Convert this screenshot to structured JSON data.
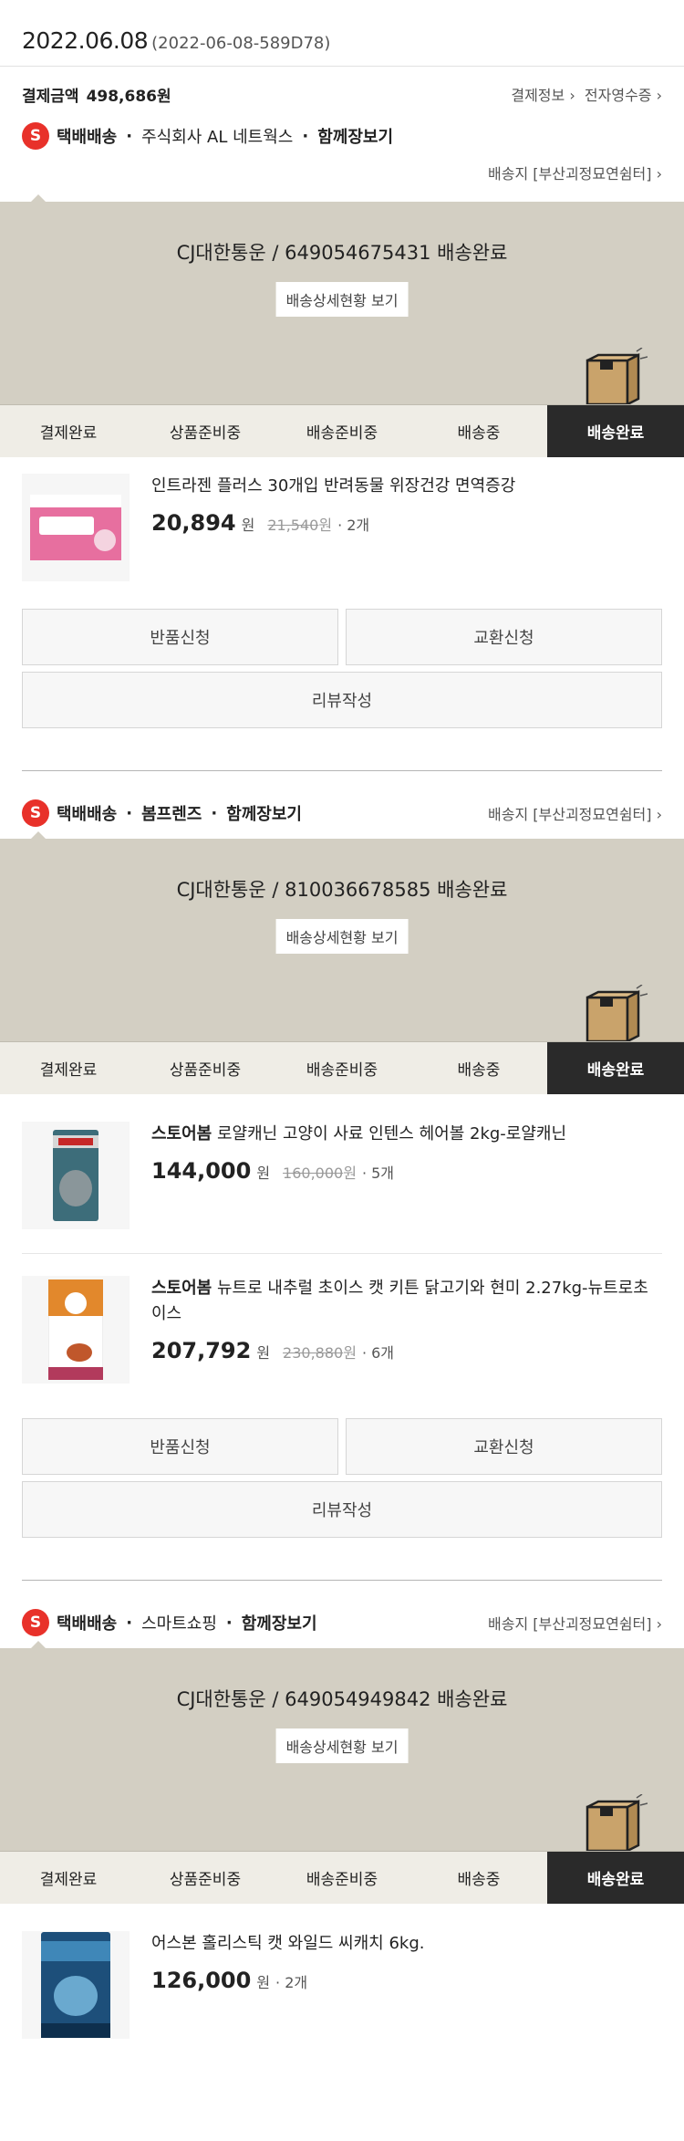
{
  "order": {
    "date": "2022.06.08",
    "order_id": "(2022-06-08-589D78)",
    "pay_label": "결제금액",
    "pay_amount": "498,686원",
    "payment_info_link": "결제정보 ›",
    "receipt_link": "전자영수증 ›"
  },
  "shipments": [
    {
      "badge": "S",
      "method": "택배배송",
      "seller": "주식회사 AL 네트웍스",
      "cart_link": "함께장보기",
      "address": "배송지 [부산괴정묘연쉼터] ›",
      "tracking_text": "CJ대한통운 / 649054675431 배송완료",
      "tracking_button": "배송상세현황 보기",
      "steps": [
        "결제완료",
        "상품준비중",
        "배송준비중",
        "배송중",
        "배송완료"
      ],
      "items": [
        {
          "store": "",
          "name": "인트라젠 플러스 30개입 반려동물 위장건강 면역증강",
          "price": "20,894",
          "won": "원",
          "original": "21,540",
          "original_won": "원",
          "qty": "· 2개",
          "thumb_label": "Intragen"
        }
      ],
      "buttons": {
        "return": "반품신청",
        "exchange": "교환신청",
        "review": "리뷰작성"
      }
    },
    {
      "badge": "S",
      "method": "택배배송",
      "seller": "봄프렌즈",
      "cart_link": "함께장보기",
      "address": "배송지 [부산괴정묘연쉼터] ›",
      "tracking_text": "CJ대한통운 / 810036678585 배송완료",
      "tracking_button": "배송상세현황 보기",
      "steps": [
        "결제완료",
        "상품준비중",
        "배송준비중",
        "배송중",
        "배송완료"
      ],
      "items": [
        {
          "store": "스토어봄",
          "name": "로얄캐닌 고양이 사료 인텐스 헤어볼 2kg-로얄캐닌",
          "price": "144,000",
          "won": "원",
          "original": "160,000",
          "original_won": "원",
          "qty": "· 5개",
          "thumb_label": "ROYAL CANIN"
        },
        {
          "store": "스토어봄",
          "name": "뉴트로 내추럴 초이스 캣 키튼 닭고기와 현미 2.27kg-뉴트로초이스",
          "price": "207,792",
          "won": "원",
          "original": "230,880",
          "original_won": "원",
          "qty": "· 6개",
          "thumb_label": "Nutro"
        }
      ],
      "buttons": {
        "return": "반품신청",
        "exchange": "교환신청",
        "review": "리뷰작성"
      }
    },
    {
      "badge": "S",
      "method": "택배배송",
      "seller": "스마트쇼핑",
      "cart_link": "함께장보기",
      "address": "배송지 [부산괴정묘연쉼터] ›",
      "tracking_text": "CJ대한통운 / 649054949842 배송완료",
      "tracking_button": "배송상세현황 보기",
      "steps": [
        "결제완료",
        "상품준비중",
        "배송준비중",
        "배송중",
        "배송완료"
      ],
      "items": [
        {
          "store": "",
          "name": "어스본 홀리스틱 캣 와일드 씨캐치 6kg.",
          "price": "126,000",
          "won": "원",
          "original": "",
          "original_won": "",
          "qty": "· 2개",
          "thumb_label": "earthborn"
        }
      ]
    }
  ],
  "colors": {
    "tracking_bg": "#d3cfc3",
    "steps_bg": "#efede6",
    "active_step": "#2a2a2a",
    "badge": "#e8312a"
  }
}
